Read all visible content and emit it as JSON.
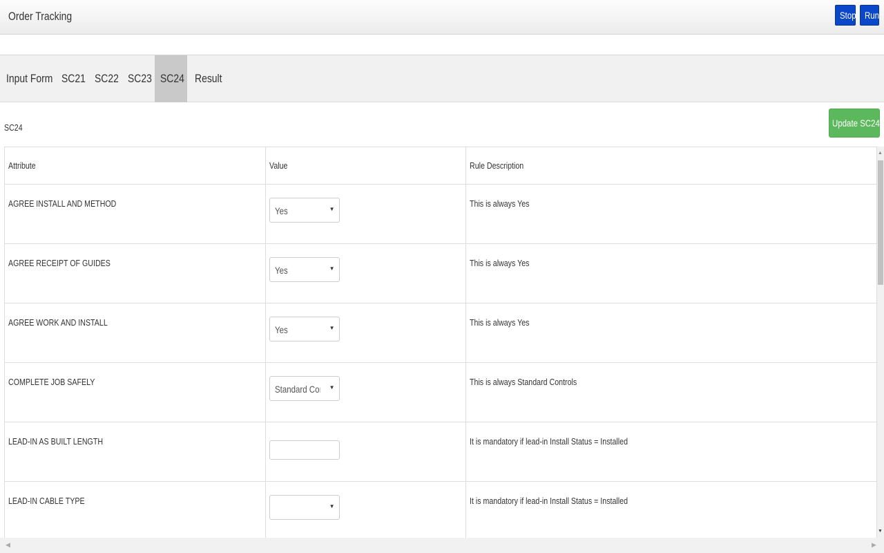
{
  "header": {
    "title": "Order Tracking",
    "buttons": {
      "stop": "Stop",
      "run": "Run"
    },
    "button_color": "#0a47c9"
  },
  "tabs": [
    {
      "label": "Input Form",
      "active": false
    },
    {
      "label": "SC21",
      "active": false
    },
    {
      "label": "SC22",
      "active": false
    },
    {
      "label": "SC23",
      "active": false
    },
    {
      "label": "SC24",
      "active": true
    },
    {
      "label": "Result",
      "active": false
    }
  ],
  "section": {
    "title": "SC24",
    "update_button": "Update SC24",
    "update_color": "#5cb85c"
  },
  "table": {
    "headers": {
      "attribute": "Attribute",
      "value": "Value",
      "rule": "Rule Description"
    },
    "rows": [
      {
        "attribute": "AGREE INSTALL AND METHOD",
        "control": "select",
        "value": "Yes",
        "rule": "This is always Yes"
      },
      {
        "attribute": "AGREE RECEIPT OF GUIDES",
        "control": "select",
        "value": "Yes",
        "rule": "This is always Yes"
      },
      {
        "attribute": "AGREE WORK AND INSTALL",
        "control": "select",
        "value": "Yes",
        "rule": "This is always Yes"
      },
      {
        "attribute": "COMPLETE JOB SAFELY",
        "control": "select",
        "value": "Standard Controls",
        "rule": "This is always Standard Controls"
      },
      {
        "attribute": "LEAD-IN AS BUILT LENGTH",
        "control": "text",
        "value": "",
        "rule": "It is mandatory if lead-in Install Status = Installed"
      },
      {
        "attribute": "LEAD-IN CABLE TYPE",
        "control": "select",
        "value": "",
        "rule": "It is mandatory if lead-in Install Status = Installed"
      }
    ]
  }
}
